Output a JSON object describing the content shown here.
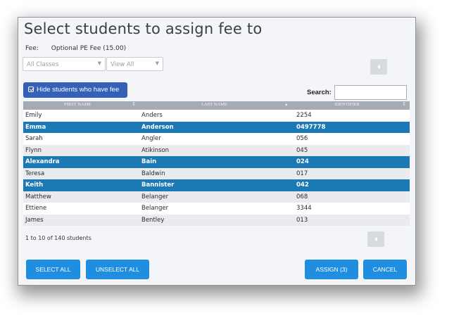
{
  "dialog": {
    "title": "Select students to assign fee to"
  },
  "fee": {
    "label": "Fee:",
    "value": "Optional PE Fee (15.00)"
  },
  "filters": {
    "classes": {
      "selected": "All Classes"
    },
    "view": {
      "selected": "View All"
    }
  },
  "hide_button": {
    "label": "Hide students who have fee"
  },
  "search": {
    "label": "Search:",
    "value": ""
  },
  "table": {
    "columns": [
      "FIRST NAME",
      "LAST NAME",
      "IDENTIFIER"
    ],
    "rows": [
      {
        "first": "Emily",
        "last": "Anders",
        "id": "2254",
        "selected": false
      },
      {
        "first": "Emma",
        "last": "Anderson",
        "id": "0497778",
        "selected": true
      },
      {
        "first": "Sarah",
        "last": "Angler",
        "id": "056",
        "selected": false
      },
      {
        "first": "Flynn",
        "last": "Atikinson",
        "id": "045",
        "selected": false
      },
      {
        "first": "Alexandra",
        "last": "Bain",
        "id": "024",
        "selected": true
      },
      {
        "first": "Teresa",
        "last": "Baldwin",
        "id": "017",
        "selected": false
      },
      {
        "first": "Keith",
        "last": "Bannister",
        "id": "042",
        "selected": true
      },
      {
        "first": "Matthew",
        "last": "Belanger",
        "id": "068",
        "selected": false
      },
      {
        "first": "Ettiene",
        "last": "Belanger",
        "id": "3344",
        "selected": false
      },
      {
        "first": "James",
        "last": "Bentley",
        "id": "013",
        "selected": false
      }
    ]
  },
  "pagination": {
    "summary": "1 to 10 of 140 students"
  },
  "buttons": {
    "select_all": "SELECT ALL",
    "unselect_all": "UNSELECT ALL",
    "assign": "ASSIGN (3)",
    "cancel": "CANCEL"
  },
  "icons": {
    "prev_page": "chevron-left-icon",
    "hide_toggle": "checkbox-checked-icon",
    "dropdown": "caret-down-icon",
    "sort": "sort-icon"
  },
  "colors": {
    "primary": "#1f8ee0",
    "hide_button": "#3460b8",
    "selected_row": "#1b7ab6",
    "header": "#a4abb3"
  }
}
